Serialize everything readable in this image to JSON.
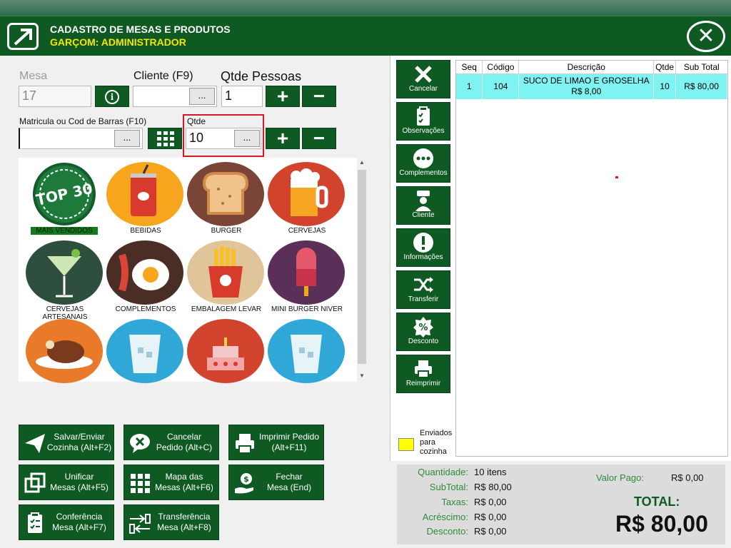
{
  "header": {
    "title": "CADASTRO DE MESAS E PRODUTOS",
    "subtitle": "GARÇOM: ADMINISTRADOR"
  },
  "form": {
    "mesa_label": "Mesa",
    "mesa_value": "17",
    "cliente_label": "Cliente (F9)",
    "cliente_value": "",
    "qtde_pessoas_label": "Qtde Pessoas",
    "qtde_pessoas_value": "1",
    "matricula_label": "Matricula ou Cod de Barras (F10)",
    "matricula_value": "",
    "qtde_label": "Qtde",
    "qtde_value": "10",
    "dots": "...",
    "plus": "+",
    "minus": "−"
  },
  "categories": [
    {
      "label": "MAIS VENDIDOS",
      "icon": "top30-badge-icon"
    },
    {
      "label": "BEBIDAS",
      "icon": "soda-can-icon"
    },
    {
      "label": "BURGER",
      "icon": "bread-icon"
    },
    {
      "label": "CERVEJAS",
      "icon": "beer-mug-icon"
    },
    {
      "label": "CERVEJAS ARTESANAIS",
      "icon": "cocktail-glass-icon"
    },
    {
      "label": "COMPLEMENTOS",
      "icon": "egg-bacon-icon"
    },
    {
      "label": "EMBALAGEM LEVAR",
      "icon": "fries-icon"
    },
    {
      "label": "MINI BURGER NIVER",
      "icon": "popsicle-icon"
    },
    {
      "label": "",
      "icon": "roast-chicken-icon"
    },
    {
      "label": "",
      "icon": "water-glass-icon"
    },
    {
      "label": "",
      "icon": "cake-icon"
    },
    {
      "label": "",
      "icon": "water-glass-icon"
    }
  ],
  "actions": [
    {
      "line1": "Salvar/Enviar",
      "line2": "Cozinha (Alt+F2)",
      "icon": "send-icon"
    },
    {
      "line1": "Cancelar",
      "line2": "Pedido (Alt+C)",
      "icon": "cancel-chat-icon"
    },
    {
      "line1": "Imprimir Pedido",
      "line2": "(Alt+F11)",
      "icon": "printer-icon"
    },
    {
      "line1": "Unificar",
      "line2": "Mesas (Alt+F5)",
      "icon": "merge-icon"
    },
    {
      "line1": "Mapa das",
      "line2": "Mesas (Alt+F6)",
      "icon": "grid-icon"
    },
    {
      "line1": "Fechar",
      "line2": "Mesa (End)",
      "icon": "pay-hand-icon"
    },
    {
      "line1": "Conferência",
      "line2": "Mesa (Alt+F7)",
      "icon": "checklist-icon"
    },
    {
      "line1": "Transferência",
      "line2": "Mesa (Alt+F8)",
      "icon": "transfer-icon"
    }
  ],
  "side": {
    "buttons": [
      {
        "label": "Cancelar",
        "icon": "x-icon"
      },
      {
        "label": "Observações",
        "icon": "clipboard-icon"
      },
      {
        "label": "Complementos",
        "icon": "more-dots-icon"
      },
      {
        "label": "Cliente",
        "icon": "user-icon"
      },
      {
        "label": "Informações",
        "icon": "alert-icon"
      },
      {
        "label": "Transferir",
        "icon": "shuffle-icon"
      },
      {
        "label": "Desconto",
        "icon": "discount-icon"
      },
      {
        "label": "Reimprimir",
        "icon": "printer-icon"
      }
    ],
    "legend": {
      "line1": "Enviados",
      "line2": "para",
      "line3": "cozinha",
      "color": "#ffff00"
    }
  },
  "table": {
    "headers": [
      "Seq",
      "Código",
      "Descrição",
      "Qtde",
      "Sub Total"
    ],
    "rows": [
      {
        "seq": "1",
        "codigo": "104",
        "descricao": "SUCO DE LIMAO E GROSELHA",
        "preco": "R$ 8,00",
        "qtde": "10",
        "subtotal": "R$ 80,00"
      }
    ]
  },
  "summary": {
    "quantidade_label": "Quantidade:",
    "quantidade_value": "10 itens",
    "subtotal_label": "SubTotal:",
    "subtotal_value": "R$ 80,00",
    "taxas_label": "Taxas:",
    "taxas_value": "R$ 0,00",
    "acrescimo_label": "Acréscimo:",
    "acrescimo_value": "R$ 0,00",
    "desconto_label": "Desconto:",
    "desconto_value": "R$ 0,00",
    "valor_pago_label": "Valor Pago:",
    "valor_pago_value": "R$ 0,00",
    "total_label": "TOTAL:",
    "total_value": "R$ 80,00"
  },
  "colors": {
    "brand": "#0f5a22",
    "accent": "#f4e600",
    "selected_row": "#7ff2f2",
    "highlight": "#d6182b"
  }
}
